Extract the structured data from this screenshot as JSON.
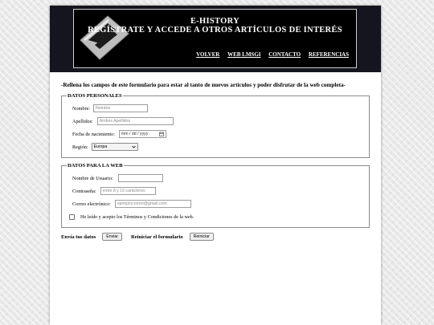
{
  "header": {
    "title": "E-HISTORY",
    "subtitle": "REGÍSTRATE Y ACCEDE A OTROS ARTÍCULOS DE INTERÉS",
    "nav": [
      "VOLVER",
      "WEB LMSGI",
      "CONTACTO",
      "REFERENCIAS"
    ]
  },
  "intro": "-Rellena los campos de este formulario para estar al tanto de nuevos artículos y poder disfrutar de la web completa-",
  "personal": {
    "legend": "DATOS PERSONALES",
    "nombre_label": "Nombre:",
    "nombre_placeholder": "Nombre",
    "apellidos_label": "Apellidos:",
    "apellidos_placeholder": "Ambos Apellidos",
    "fecha_label": "Fecha de nacimiento:",
    "fecha_placeholder": "mm / dd / yyyy",
    "region_label": "Región:",
    "region_value": "Europa"
  },
  "web": {
    "legend": "DATOS PARA LA WEB",
    "usuario_label": "Nombre de Usuario:",
    "usuario_placeholder": "",
    "password_label": "Contraseña:",
    "password_placeholder": "entre 8 y 16 carácteres",
    "email_label": "Correo electrónico:",
    "email_placeholder": "ejemplocorreo@gmail.com",
    "terms_label": "He leído y acepto los Términos y Condiciones de la web."
  },
  "actions": {
    "send_label": "Envía tus datos",
    "send_button": "Enviar",
    "reset_label": "Reiniciar el formulario",
    "reset_button": "Reiniciar"
  }
}
